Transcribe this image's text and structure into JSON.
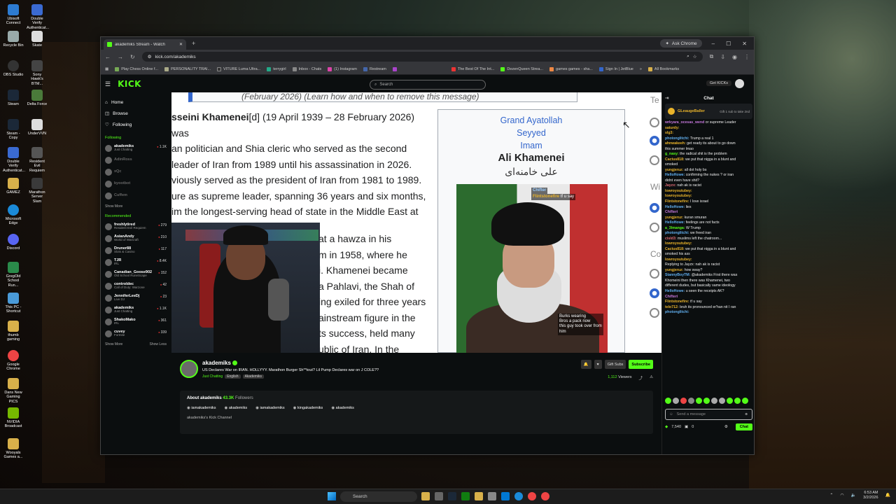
{
  "desktop": {
    "icons_left": [
      "Ubisoft Connect",
      "Recycle Bin",
      "OBS Studio",
      "Steam",
      "Steam - Copy",
      "Double Verify Authenticat...",
      "GAMEZ",
      "Microsoft Edge",
      "Discord",
      "GregOld School Run...",
      "This PC - Shortcut",
      "thumb gaming",
      "Google Chrome",
      "Dans New Gaming PICS",
      "NVIDIA Broadcast",
      "Wooyals Games a..."
    ],
    "icons_right": [
      "Double Verify Authenticat...",
      "Skate",
      "Sony Hawk's BTM...",
      "Delta Force",
      "UnderVVN",
      "Resident Evil Requiem",
      "Marathon Server Slam"
    ]
  },
  "browser": {
    "tab_title": "akademiks Stream - Watch",
    "new_tab": "+",
    "ask_chrome": "Ask Chrome",
    "url": "kick.com/akademiks",
    "bookmarks": [
      "Play Chess Online f...",
      "PERSONALITY TRAI...",
      "VITURE Luma Ultra...",
      "terrygirl",
      "Inbox - Chats",
      "(1) Instagram",
      "Restream",
      "The Best Of The Int...",
      "DezenQueen Strea...",
      "games games - sha...",
      "Sign In | JetBlue",
      "All Bookmarks"
    ]
  },
  "kick": {
    "logo": "KICK",
    "search_placeholder": "Search",
    "get_kick": "Get KICKs",
    "nav": [
      "Home",
      "Browse",
      "Following"
    ],
    "following_label": "Following",
    "following": [
      {
        "name": "akademiks",
        "cat": "Just Chatting",
        "count": "1.1K"
      },
      {
        "name": "AdinRoss",
        "cat": "",
        "count": ""
      },
      {
        "name": "xQc",
        "cat": "",
        "count": ""
      },
      {
        "name": "kyootbot",
        "cat": "",
        "count": ""
      },
      {
        "name": "Cuffem",
        "cat": "",
        "count": ""
      }
    ],
    "show_more": "Show More",
    "recommended_label": "Recommended",
    "recommended": [
      {
        "name": "freshlytired",
        "cat": "Resident Evil Requiem",
        "count": "279"
      },
      {
        "name": "AsianAndy",
        "cat": "World of Warcraft",
        "count": "210"
      },
      {
        "name": "Druner88",
        "cat": "Slots & Casino",
        "count": "117"
      },
      {
        "name": "TJR",
        "cat": "IRL",
        "count": "8.4K"
      },
      {
        "name": "Canadian_Goose902",
        "cat": "Old School RuneScape",
        "count": "152"
      },
      {
        "name": "controldec",
        "cat": "Call of Duty: Warzone",
        "count": "42"
      },
      {
        "name": "JenniferLeeDj",
        "cat": "Live DJ",
        "count": "23"
      },
      {
        "name": "akademiks",
        "cat": "Just Chatting",
        "count": "1.1K"
      },
      {
        "name": "ShakoMako",
        "cat": "IRL",
        "count": "361"
      },
      {
        "name": "cuvey",
        "cat": "Fortnite",
        "count": "339"
      }
    ],
    "show_less": "Show Less"
  },
  "wiki": {
    "notice": "(February 2026) (Learn how and when to remove this message)",
    "lines": [
      "sseini Khamenei",
      "an politician and Shia cleric who served as the second",
      "leader of Iran from 1989 until his assassination in 2026.",
      "viously served as the president of Iran from 1981 to 1989.",
      "ure as supreme leader, spanning 36 years and six months,",
      "im the longest-serving head of state in the Middle East at",
      "e of his death."
    ],
    "dates": "[d] (19 April 1939 – 28 February 2026) was",
    "lines2": [
      "at a hawza in his",
      "m in 1958, where he",
      "i. Khamenei became",
      "a Pahlavi, the Shah of",
      "ing exiled for three years",
      "ainstream figure in the",
      "ts success, held many",
      "ublic of Iran. In the"
    ],
    "infobox_title": [
      "Grand Ayatollah",
      "Seyyed",
      "Imam"
    ],
    "infobox_name": "Ali Khamenei",
    "infobox_arabic": "علی خامنه‌ای",
    "right_edge": [
      "Te",
      "Wi",
      "Co"
    ]
  },
  "overlays": [
    {
      "user": "Chifter",
      "text": ""
    },
    {
      "user": "Flintstonefire",
      "text": "tf u say"
    },
    {
      "user": "",
      "text": "Burks wearing"
    },
    {
      "user": "",
      "text": "Bros a pack now"
    },
    {
      "user": "",
      "text": "this guy took over from"
    },
    {
      "user": "",
      "text": "him"
    }
  ],
  "stream": {
    "name": "akademiks",
    "title": "US Declares War on IRAN. HOLLYYY. Marathon Burger Sh**tout? Lil Pump Declares war on J COLE??",
    "category": "Just Chatting",
    "tags": [
      "English",
      "Akademiks"
    ],
    "gift": "Gift Subs",
    "subscribe": "Subscribe",
    "viewers": "1,112",
    "viewers_label": "Viewers",
    "about_label": "About akademiks",
    "followers": "43.3K",
    "followers_label": "Followers",
    "socials": [
      "iamakademiks",
      "akademiks",
      "iamakademiks",
      "kingakademiks",
      "akademiks"
    ],
    "description": "akademiks's Kick Channel"
  },
  "chat": {
    "title": "Chat",
    "pinned_user": "GLeaugeBaller",
    "pinned_text": "Gift 1 sub to take 2nd",
    "messages": [
      {
        "u": "wrkyara_ocesas_wend",
        "t": "or supreme Leader",
        "c": "#c678dd"
      },
      {
        "u": "saturdy:",
        "t": "",
        "c": "#e9b32a"
      },
      {
        "u": "slg3:",
        "t": "",
        "c": "#e9b32a"
      },
      {
        "u": "photonglitchi:",
        "t": "Trump a real 1",
        "c": "#61afef"
      },
      {
        "u": "ahnwakeeh:",
        "t": "get ready its about to go down",
        "c": "#e9b32a"
      },
      {
        "u": "",
        "t": "this summer lmao",
        "c": "#eee"
      },
      {
        "u": "g_nasy:",
        "t": "the radical shit is the problem",
        "c": "#53fc18"
      },
      {
        "u": "Cactus818:",
        "t": "we put that nigga in a blunt and",
        "c": "#e9b32a"
      },
      {
        "u": "",
        "t": "smoked",
        "c": "#eee"
      },
      {
        "u": "yungjeruz:",
        "t": "all dot holy bs",
        "c": "#e9b32a"
      },
      {
        "u": "HelloHowe:",
        "t": "confirming the nukes ? or iran",
        "c": "#61afef"
      },
      {
        "u": "",
        "t": "didnt even have shit?",
        "c": "#eee"
      },
      {
        "u": "Jayzx:",
        "t": "nah ak is racist",
        "c": "#e06c75"
      },
      {
        "u": "lowroyoutubey:",
        "t": "",
        "c": "#e9b32a"
      },
      {
        "u": "lowroyoutubey:",
        "t": "",
        "c": "#e9b32a"
      },
      {
        "u": "Flintstonefire:",
        "t": "I love israel",
        "c": "#e9b32a"
      },
      {
        "u": "HelloHowe:",
        "t": "lies",
        "c": "#61afef"
      },
      {
        "u": "Chifteri",
        "t": "",
        "c": "#c678dd"
      },
      {
        "u": "yungjeruz:",
        "t": "kuran smuran",
        "c": "#e9b32a"
      },
      {
        "u": "HelloHowe:",
        "t": "feelings are not facts",
        "c": "#61afef"
      },
      {
        "u": "a_3lmanga:",
        "t": "W Trump",
        "c": "#53fc18"
      },
      {
        "u": "photonglitchi:",
        "t": "we freed iran",
        "c": "#61afef"
      },
      {
        "u": "cisld3:",
        "t": "muslims left the chatroom...",
        "c": "#e06c75"
      },
      {
        "u": "lowroyoutubey:",
        "t": "",
        "c": "#e9b32a"
      },
      {
        "u": "Cactus818:",
        "t": "we put that nigga in a blunt and",
        "c": "#e9b32a"
      },
      {
        "u": "",
        "t": "smoked his ass",
        "c": "#eee"
      },
      {
        "u": "lowroyoutubey:",
        "t": "",
        "c": "#e9b32a"
      },
      {
        "u": "",
        "t": "Replying to Jayzx: nah ak is racist",
        "c": "#888"
      },
      {
        "u": "yungjeruz:",
        "t": "how sway?",
        "c": "#e9b32a"
      },
      {
        "u": "StannyBoyTM:",
        "t": "@akademiks First there was",
        "c": "#61afef"
      },
      {
        "u": "",
        "t": "Khomeini then there was Khamenei, two",
        "c": "#eee"
      },
      {
        "u": "",
        "t": "different dudes, but basically same ideology",
        "c": "#eee"
      },
      {
        "u": "HelloHowe:",
        "t": "u seen the receipts AK?",
        "c": "#61afef"
      },
      {
        "u": "Chifteri",
        "t": "",
        "c": "#c678dd"
      },
      {
        "u": "Flintstonefire:",
        "t": "tf u say",
        "c": "#e9b32a"
      },
      {
        "u": "telo712:",
        "t": "bruh its pronounced er'han nit I ran",
        "c": "#e9b32a"
      },
      {
        "u": "photonglitchi:",
        "t": "",
        "c": "#61afef"
      }
    ],
    "input_placeholder": "Send a message",
    "points": "7,540",
    "points2": "0",
    "chat_button": "Chat"
  },
  "taskbar": {
    "search": "Search",
    "time": "6:53 AM",
    "date": "3/2/2026"
  }
}
